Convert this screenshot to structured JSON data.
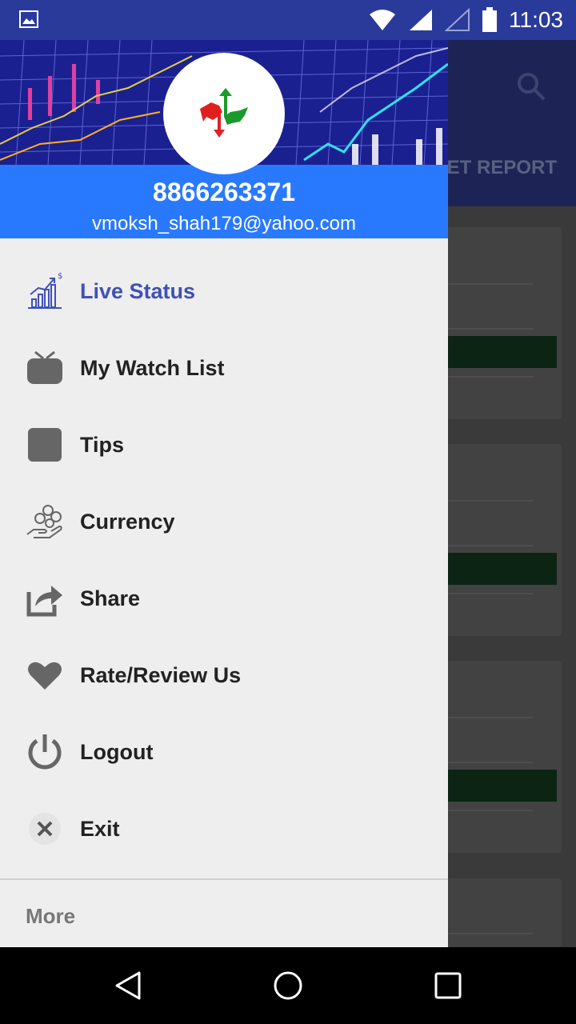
{
  "status_bar": {
    "time": "11:03",
    "icons": [
      "image-icon",
      "wifi-icon",
      "signal-icon",
      "signal-empty-icon",
      "battery-icon"
    ]
  },
  "background_app": {
    "tab_label": "KET REPORT",
    "icons": [
      "search-icon"
    ]
  },
  "drawer": {
    "header": {
      "phone": "8866263371",
      "email": "vmoksh_shah179@yahoo.com",
      "logo_icon": "bull-bear-logo-icon"
    },
    "menu": [
      {
        "label": "Live Status",
        "icon": "chart-growth-icon",
        "active": true
      },
      {
        "label": "My Watch List",
        "icon": "tv-icon",
        "active": false
      },
      {
        "label": "Tips",
        "icon": "square-icon",
        "active": false
      },
      {
        "label": "Currency",
        "icon": "currency-hand-icon",
        "active": false
      },
      {
        "label": "Share",
        "icon": "share-icon",
        "active": false
      },
      {
        "label": "Rate/Review Us",
        "icon": "heart-icon",
        "active": false
      },
      {
        "label": "Logout",
        "icon": "power-icon",
        "active": false
      },
      {
        "label": "Exit",
        "icon": "close-icon",
        "active": false
      }
    ],
    "more_label": "More"
  },
  "nav_bar": {
    "icons": [
      "back-icon",
      "home-icon",
      "recents-icon"
    ]
  },
  "colors": {
    "status_bar": "#2a3a9b",
    "header_blue": "#2979ff",
    "active_text": "#3f51b5",
    "drawer_bg": "#eeeeee"
  }
}
